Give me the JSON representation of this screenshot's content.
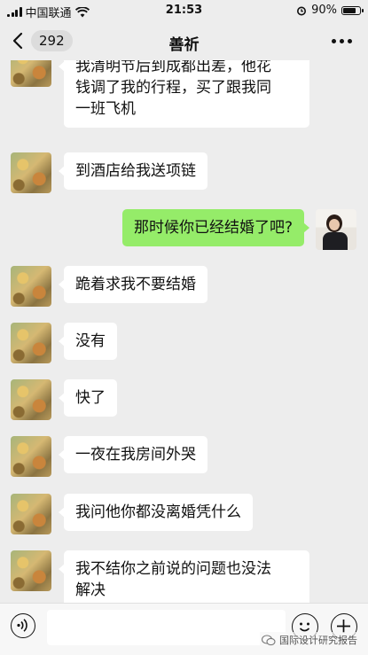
{
  "status_bar": {
    "carrier": "中国联通",
    "time": "21:53",
    "battery": "90%",
    "battery_level": 0.9,
    "icons": [
      "signal-icon",
      "wifi-icon",
      "alarm-icon",
      "battery-icon"
    ]
  },
  "nav": {
    "back_count": "292",
    "title": "善祈",
    "icons": [
      "back-arrow-icon",
      "more-icon"
    ]
  },
  "messages": [
    {
      "side": "left",
      "text_lines": [
        "我清明节后到成都出差，他花",
        "钱调了我的行程，买了跟我同",
        "一班飞机"
      ]
    },
    {
      "side": "left",
      "text_lines": [
        "到酒店给我送项链"
      ]
    },
    {
      "side": "right",
      "text_lines": [
        "那时候你已经结婚了吧?"
      ]
    },
    {
      "side": "left",
      "text_lines": [
        "跪着求我不要结婚"
      ]
    },
    {
      "side": "left",
      "text_lines": [
        "没有"
      ]
    },
    {
      "side": "left",
      "text_lines": [
        "快了"
      ]
    },
    {
      "side": "left",
      "text_lines": [
        "一夜在我房间外哭"
      ]
    },
    {
      "side": "left",
      "text_lines": [
        "我问他你都没离婚凭什么"
      ]
    },
    {
      "side": "left",
      "text_lines": [
        "我不结你之前说的问题也没法",
        "解决"
      ]
    }
  ],
  "input_bar": {
    "placeholder": "",
    "icons": [
      "voice-icon",
      "emoji-icon",
      "plus-icon"
    ]
  },
  "watermark": {
    "text": "国际设计研究报告",
    "icon": "wechat-official-icon"
  },
  "colors": {
    "background": "#ededed",
    "incoming_bubble": "#ffffff",
    "outgoing_bubble": "#95ec69"
  }
}
